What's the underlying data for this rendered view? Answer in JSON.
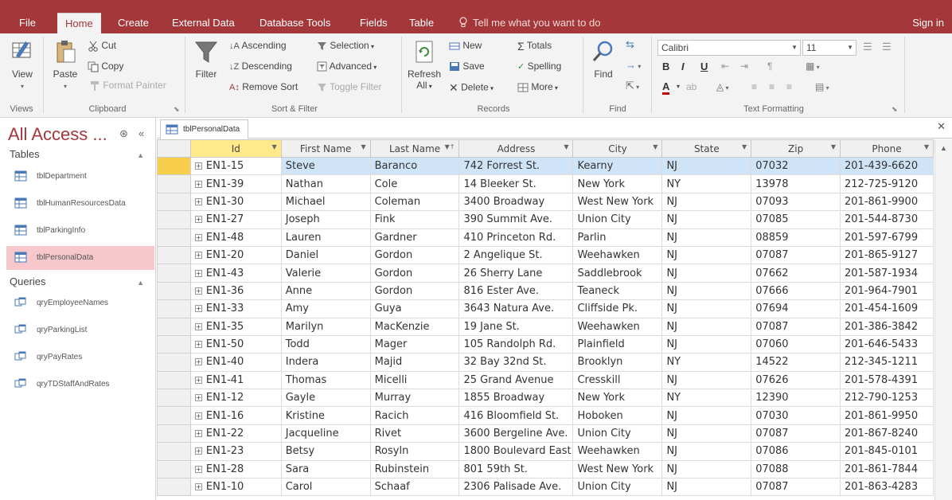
{
  "tabs": {
    "file": "File",
    "home": "Home",
    "create": "Create",
    "external": "External Data",
    "dbtools": "Database Tools",
    "fields": "Fields",
    "table": "Table",
    "tell_me": "Tell me what you want to do",
    "sign_in": "Sign in"
  },
  "ribbon": {
    "views": {
      "view": "View",
      "label": "Views"
    },
    "clipboard": {
      "paste": "Paste",
      "cut": "Cut",
      "copy": "Copy",
      "format_painter": "Format Painter",
      "label": "Clipboard"
    },
    "sort_filter": {
      "filter": "Filter",
      "ascending": "Ascending",
      "descending": "Descending",
      "remove_sort": "Remove Sort",
      "selection": "Selection",
      "advanced": "Advanced",
      "toggle_filter": "Toggle Filter",
      "label": "Sort & Filter"
    },
    "records": {
      "refresh": "Refresh",
      "refresh_all": "All",
      "new": "New",
      "save": "Save",
      "delete": "Delete",
      "totals": "Totals",
      "spelling": "Spelling",
      "more": "More",
      "label": "Records"
    },
    "find": {
      "find": "Find",
      "label": "Find"
    },
    "text_formatting": {
      "font": "Calibri",
      "size": "11",
      "label": "Text Formatting"
    }
  },
  "nav": {
    "title": "All Access ...",
    "tables_header": "Tables",
    "queries_header": "Queries",
    "tables": [
      "tblDepartment",
      "tblHumanResourcesData",
      "tblParkingInfo",
      "tblPersonalData"
    ],
    "queries": [
      "qryEmployeeNames",
      "qryParkingList",
      "qryPayRates",
      "qryTDStaffAndRates"
    ]
  },
  "document": {
    "tab_label": "tblPersonalData"
  },
  "grid": {
    "columns": [
      "Id",
      "First Name",
      "Last Name",
      "Address",
      "City",
      "State",
      "Zip",
      "Phone"
    ],
    "rows": [
      [
        "EN1-15",
        "Steve",
        "Baranco",
        "742 Forrest St.",
        "Kearny",
        "NJ",
        "07032",
        "201-439-6620"
      ],
      [
        "EN1-39",
        "Nathan",
        "Cole",
        "14 Bleeker St.",
        "New York",
        "NY",
        "13978",
        "212-725-9120"
      ],
      [
        "EN1-30",
        "Michael",
        "Coleman",
        "3400 Broadway",
        "West New York",
        "NJ",
        "07093",
        "201-861-9900"
      ],
      [
        "EN1-27",
        "Joseph",
        "Fink",
        "390 Summit Ave.",
        "Union City",
        "NJ",
        "07085",
        "201-544-8730"
      ],
      [
        "EN1-48",
        "Lauren",
        "Gardner",
        "410 Princeton Rd.",
        "Parlin",
        "NJ",
        "08859",
        "201-597-6799"
      ],
      [
        "EN1-20",
        "Daniel",
        "Gordon",
        "2 Angelique St.",
        "Weehawken",
        "NJ",
        "07087",
        "201-865-9127"
      ],
      [
        "EN1-43",
        "Valerie",
        "Gordon",
        "26 Sherry Lane",
        "Saddlebrook",
        "NJ",
        "07662",
        "201-587-1934"
      ],
      [
        "EN1-36",
        "Anne",
        "Gordon",
        "816 Ester Ave.",
        "Teaneck",
        "NJ",
        "07666",
        "201-964-7901"
      ],
      [
        "EN1-33",
        "Amy",
        "Guya",
        "3643 Natura Ave.",
        "Cliffside Pk.",
        "NJ",
        "07694",
        "201-454-1609"
      ],
      [
        "EN1-35",
        "Marilyn",
        "MacKenzie",
        "19 Jane St.",
        "Weehawken",
        "NJ",
        "07087",
        "201-386-3842"
      ],
      [
        "EN1-50",
        "Todd",
        "Mager",
        "105 Randolph Rd.",
        "Plainfield",
        "NJ",
        "07060",
        "201-646-5433"
      ],
      [
        "EN1-40",
        "Indera",
        "Majid",
        "32 Bay 32nd St.",
        "Brooklyn",
        "NY",
        "14522",
        "212-345-1211"
      ],
      [
        "EN1-41",
        "Thomas",
        "Micelli",
        "25 Grand Avenue",
        "Cresskill",
        "NJ",
        "07626",
        "201-578-4391"
      ],
      [
        "EN1-12",
        "Gayle",
        "Murray",
        "1855 Broadway",
        "New York",
        "NY",
        "12390",
        "212-790-1253"
      ],
      [
        "EN1-16",
        "Kristine",
        "Racich",
        "416 Bloomfield St.",
        "Hoboken",
        "NJ",
        "07030",
        "201-861-9950"
      ],
      [
        "EN1-22",
        "Jacqueline",
        "Rivet",
        "3600 Bergeline Ave.",
        "Union City",
        "NJ",
        "07087",
        "201-867-8240"
      ],
      [
        "EN1-23",
        "Betsy",
        "Rosyln",
        "1800 Boulevard East",
        "Weehawken",
        "NJ",
        "07086",
        "201-845-0101"
      ],
      [
        "EN1-28",
        "Sara",
        "Rubinstein",
        "801 59th St.",
        "West New York",
        "NJ",
        "07088",
        "201-861-7844"
      ],
      [
        "EN1-10",
        "Carol",
        "Schaaf",
        "2306 Palisade Ave.",
        "Union City",
        "NJ",
        "07087",
        "201-863-4283"
      ]
    ]
  },
  "colors": {
    "accent": "#a4373a",
    "selected_row": "#cfe4f7",
    "nav_selected": "#f6c8cb"
  }
}
